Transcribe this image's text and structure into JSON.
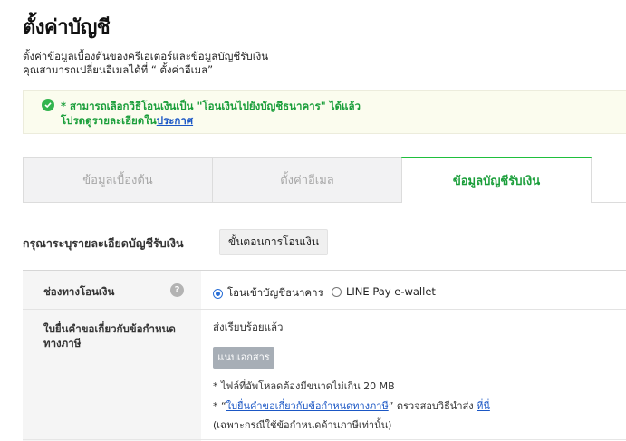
{
  "page": {
    "title": "ตั้งค่าบัญชี",
    "description_line1": "ตั้งค่าข้อมูลเบื้องต้นของครีเอเตอร์และข้อมูลบัญชีรับเงิน",
    "description_line2": "คุณสามารถเปลี่ยนอีเมลได้ที่ “ ตั้งค่าอีเมล”"
  },
  "notice": {
    "line1": "* สามารถเลือกวิธีโอนเงินเป็น \"โอนเงินไปยังบัญชีธนาคาร\" ได้แล้ว",
    "line2_prefix": "โปรดดูรายละเอียดใน",
    "line2_link": "ประกาศ",
    "icon": "check-circle-icon",
    "color": "#1a9e3a"
  },
  "tabs": [
    {
      "label": "ข้อมูลเบื้องต้น",
      "active": false
    },
    {
      "label": "ตั้งค่าอีเมล",
      "active": false
    },
    {
      "label": "ข้อมูลบัญชีรับเงิน",
      "active": true
    }
  ],
  "section": {
    "heading": "กรุณาระบุรายละเอียดบัญชีรับเงิน",
    "steps_button": "ขั้นตอนการโอนเงิน"
  },
  "form": {
    "transfer_channel": {
      "label": "ช่องทางโอนเงิน",
      "help_icon": "?",
      "options": [
        {
          "label": "โอนเข้าบัญชีธนาคาร",
          "selected": true
        },
        {
          "label": "LINE Pay e-wallet",
          "selected": false
        }
      ]
    },
    "tax_form": {
      "label": "ใบยื่นคำขอเกี่ยวกับข้อกำหนดทางภาษี",
      "status": "ส่งเรียบร้อยแล้ว",
      "attach_button": "แนบเอกสาร",
      "note1": "* ไฟล์ที่อัพโหลดต้องมีขนาดไม่เกิน 20 MB",
      "note2_prefix": "* “",
      "note2_link": "ใบยื่นคำขอเกี่ยวกับข้อกำหนดทางภาษี",
      "note2_middle": "” ตรวจสอบวิธีนำส่ง",
      "note2_link2": "ที่นี่",
      "note3": "(เฉพาะกรณีใช้ข้อกำหนดด้านภาษีเท่านั้น)"
    }
  },
  "colors": {
    "accent_green": "#1fbf3c",
    "link_blue": "#1b57c5",
    "radio_blue": "#2a6fd6"
  }
}
